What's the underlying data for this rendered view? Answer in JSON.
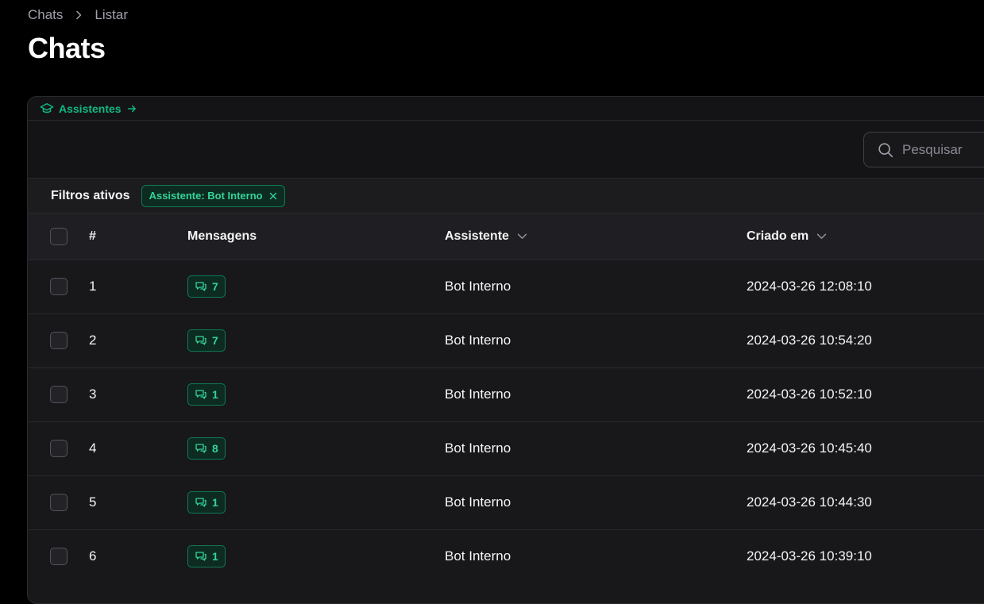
{
  "breadcrumb": {
    "items": [
      "Chats",
      "Listar"
    ]
  },
  "page": {
    "title": "Chats"
  },
  "panel": {
    "header_link": "Assistentes"
  },
  "toolbar": {
    "search_placeholder": "Pesquisar"
  },
  "filters": {
    "label": "Filtros ativos",
    "chips": [
      "Assistente: Bot Interno"
    ]
  },
  "table": {
    "columns": {
      "id": "#",
      "messages": "Mensagens",
      "assistant": "Assistente",
      "created": "Criado em"
    },
    "rows": [
      {
        "id": "1",
        "messages": "7",
        "assistant": "Bot Interno",
        "created": "2024-03-26 12:08:10"
      },
      {
        "id": "2",
        "messages": "7",
        "assistant": "Bot Interno",
        "created": "2024-03-26 10:54:20"
      },
      {
        "id": "3",
        "messages": "1",
        "assistant": "Bot Interno",
        "created": "2024-03-26 10:52:10"
      },
      {
        "id": "4",
        "messages": "8",
        "assistant": "Bot Interno",
        "created": "2024-03-26 10:45:40"
      },
      {
        "id": "5",
        "messages": "1",
        "assistant": "Bot Interno",
        "created": "2024-03-26 10:44:30"
      },
      {
        "id": "6",
        "messages": "1",
        "assistant": "Bot Interno",
        "created": "2024-03-26 10:39:10"
      }
    ]
  },
  "icons": {
    "breadcrumb_separator": "chevron-right-icon",
    "panel_header": "graduation-cap-icon",
    "panel_header_arrow": "arrow-right-icon",
    "search": "search-icon",
    "filter_remove": "close-icon",
    "sort": "chevron-down-icon",
    "messages": "chat-bubbles-icon"
  },
  "colors": {
    "background": "#000000",
    "panel": "#18181b",
    "accent": "#10b981",
    "accent_text": "#34d399",
    "badge_bg": "#0d2b21",
    "border": "#2a2a2e"
  }
}
